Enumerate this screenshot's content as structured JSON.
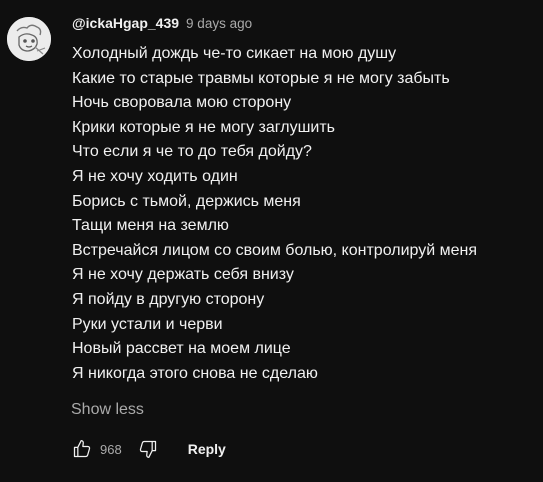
{
  "comment": {
    "author": "@ickaHgap_439",
    "timestamp": "9 days ago",
    "lines": [
      "Холодный дождь че-то сикает на мою душу",
      "Какие то старые травмы которые я не могу забыть",
      "Ночь своровала мою сторону",
      "Крики которые я не могу заглушить",
      "Что если я че то до тебя дойду?",
      "Я не хочу ходить один",
      "Борись с тьмой, держись меня",
      "Тащи меня на землю",
      "Встречайся лицом со своим болью, контролируй меня",
      "Я не хочу держать себя внизу",
      "Я пойду в другую сторону",
      "Руки устали и черви",
      "Новый рассвет на моем лице",
      "Я никогда этого снова не сделаю"
    ],
    "show_less_label": "Show less",
    "like_count": "968",
    "reply_label": "Reply",
    "icons": {
      "avatar": "avatar-image",
      "like": "thumbs-up-icon",
      "dislike": "thumbs-down-icon"
    }
  }
}
